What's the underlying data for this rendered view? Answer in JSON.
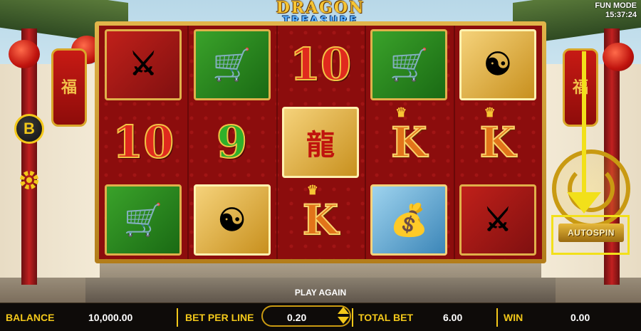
{
  "header": {
    "title_line1": "DRAGON",
    "title_line2": "TREASURE",
    "mode": "FUN MODE",
    "clock": "15:37:24"
  },
  "left_controls": {
    "bonus_button_label": "B"
  },
  "reels": {
    "rows": [
      [
        "weapons-rack",
        "chariot",
        "10",
        "chariot",
        "warrior"
      ],
      [
        "10",
        "9",
        "dragon-flag",
        "K",
        "K"
      ],
      [
        "chariot",
        "warrior",
        "K",
        "treasure-chest",
        "weapons-rack"
      ]
    ]
  },
  "spin": {
    "autospin_label": "AUTOSPIN"
  },
  "status": {
    "play_again": "PLAY AGAIN"
  },
  "bottom_bar": {
    "balance_label": "BALANCE",
    "balance_value": "10,000.00",
    "bet_per_line_label": "BET PER LINE",
    "bet_per_line_value": "0.20",
    "total_bet_label": "TOTAL BET",
    "total_bet_value": "6.00",
    "win_label": "WIN",
    "win_value": "0.00"
  },
  "colors": {
    "accent_gold": "#f3c81a",
    "reel_red": "#8c0d0d",
    "highlight_yellow": "#f2e01a"
  }
}
